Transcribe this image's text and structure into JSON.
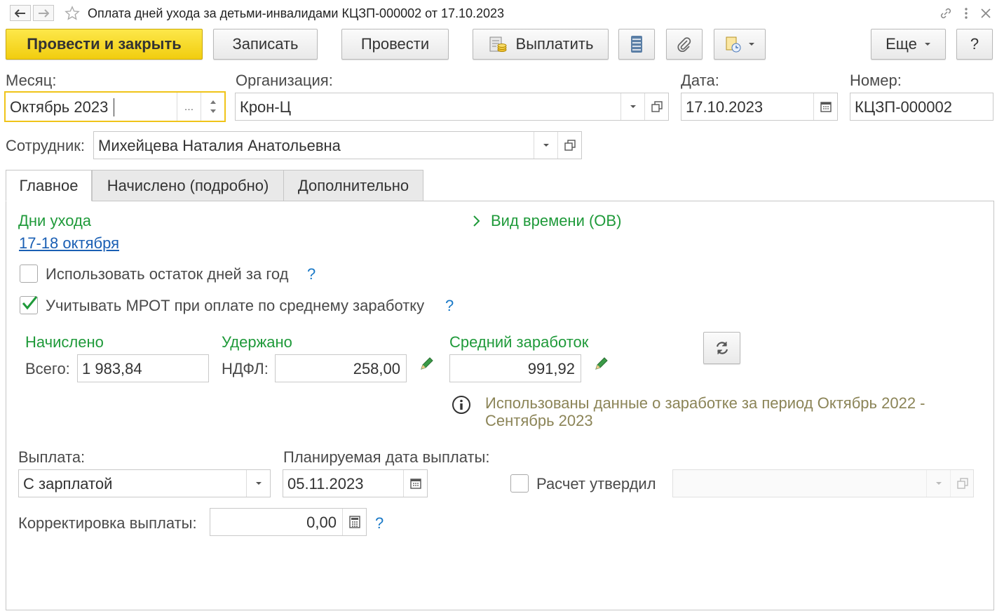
{
  "window": {
    "title": "Оплата дней ухода за детьми-инвалидами КЦЗП-000002 от 17.10.2023"
  },
  "toolbar": {
    "post_close": "Провести и закрыть",
    "save": "Записать",
    "post": "Провести",
    "pay": "Выплатить",
    "more": "Еще",
    "help": "?"
  },
  "header": {
    "month_label": "Месяц:",
    "month_value": "Октябрь 2023",
    "org_label": "Организация:",
    "org_value": "Крон-Ц",
    "date_label": "Дата:",
    "date_value": "17.10.2023",
    "number_label": "Номер:",
    "number_value": "КЦЗП-000002",
    "employee_label": "Сотрудник:",
    "employee_value": "Михейцева Наталия Анатольевна"
  },
  "tabs": [
    {
      "label": "Главное"
    },
    {
      "label": "Начислено (подробно)"
    },
    {
      "label": "Дополнительно"
    }
  ],
  "main": {
    "care_days_title": "Дни ухода",
    "care_days_link": "17-18 октября",
    "time_kind_label": "Вид времени (ОВ)",
    "use_remaining_label": "Использовать остаток дней за год",
    "use_remaining_checked": false,
    "mrot_label": "Учитывать МРОТ при оплате по среднему заработку",
    "mrot_checked": true,
    "accrued_title": "Начислено",
    "total_label": "Всего:",
    "total_value": "1 983,84",
    "withheld_title": "Удержано",
    "ndfl_label": "НДФЛ:",
    "ndfl_value": "258,00",
    "avg_title": "Средний заработок",
    "avg_value": "991,92",
    "info_text_1": "Использованы данные о заработке за период Октябрь 2022 -",
    "info_text_2": "Сентябрь 2023",
    "payment_label": "Выплата:",
    "payment_value": "С зарплатой",
    "planned_date_label": "Планируемая дата выплаты:",
    "planned_date_value": "05.11.2023",
    "approved_label": "Расчет утвердил",
    "approved_checked": false,
    "approved_value": "",
    "correction_label": "Корректировка выплаты:",
    "correction_value": "0,00",
    "help_mark": "?"
  },
  "colors": {
    "primary_button": "#f5d623",
    "group_title": "#1f9a3a",
    "link": "#1a5fb4",
    "info_text": "#8b8457",
    "focused_border": "#f0c419"
  }
}
